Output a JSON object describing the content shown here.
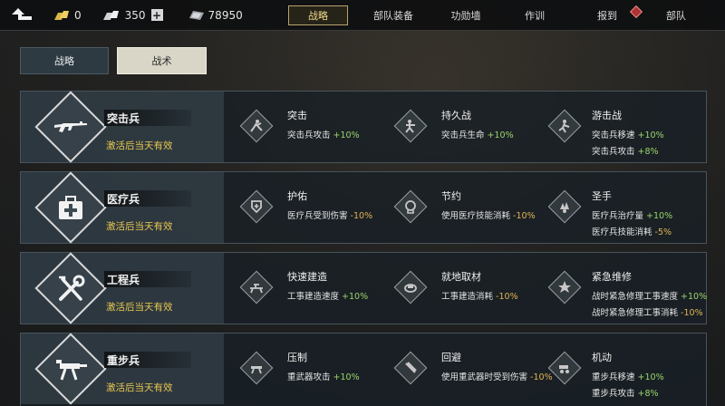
{
  "topbar": {
    "gold": "0",
    "fuel": "350",
    "silver": "78950",
    "nav": [
      "战略",
      "部队装备",
      "功勋墙",
      "作训",
      "报到",
      "部队"
    ],
    "active": "战略"
  },
  "tabs": [
    "战略",
    "战术"
  ],
  "active_tab": "战术",
  "classes": [
    {
      "name": "突击兵",
      "note": "激活后当天有效",
      "icon": "rifle-icon",
      "perks": [
        {
          "title": "突击",
          "icon": "assault-perk-icon",
          "lines": [
            {
              "label": "突击兵攻击",
              "value": "+10%"
            }
          ]
        },
        {
          "title": "持久战",
          "icon": "endurance-perk-icon",
          "lines": [
            {
              "label": "突击兵生命",
              "value": "+10%"
            }
          ]
        },
        {
          "title": "游击战",
          "icon": "guerrilla-perk-icon",
          "lines": [
            {
              "label": "突击兵移速",
              "value": "+10%"
            },
            {
              "label": "突击兵攻击",
              "value": "+8%"
            }
          ]
        }
      ]
    },
    {
      "name": "医疗兵",
      "note": "激活后当天有效",
      "icon": "medkit-icon",
      "perks": [
        {
          "title": "护佑",
          "icon": "shield-perk-icon",
          "lines": [
            {
              "label": "医疗兵受到伤害",
              "value": "-10%"
            }
          ]
        },
        {
          "title": "节约",
          "icon": "save-perk-icon",
          "lines": [
            {
              "label": "使用医疗技能消耗",
              "value": "-10%"
            }
          ]
        },
        {
          "title": "圣手",
          "icon": "hand-perk-icon",
          "lines": [
            {
              "label": "医疗兵治疗量",
              "value": "+10%"
            },
            {
              "label": "医疗兵技能消耗",
              "value": "-5%"
            }
          ]
        }
      ]
    },
    {
      "name": "工程兵",
      "note": "激活后当天有效",
      "icon": "wrench-icon",
      "perks": [
        {
          "title": "快速建造",
          "icon": "build-perk-icon",
          "lines": [
            {
              "label": "工事建造速度",
              "value": "+10%"
            }
          ]
        },
        {
          "title": "就地取材",
          "icon": "material-perk-icon",
          "lines": [
            {
              "label": "工事建造消耗",
              "value": "-10%"
            }
          ]
        },
        {
          "title": "紧急维修",
          "icon": "repair-perk-icon",
          "lines": [
            {
              "label": "战时紧急修理工事速度",
              "value": "+10%"
            },
            {
              "label": "战时紧急修理工事消耗",
              "value": "-10%"
            }
          ]
        }
      ]
    },
    {
      "name": "重步兵",
      "note": "激活后当天有效",
      "icon": "heavy-gun-icon",
      "perks": [
        {
          "title": "压制",
          "icon": "suppress-perk-icon",
          "lines": [
            {
              "label": "重武器攻击",
              "value": "+10%"
            }
          ]
        },
        {
          "title": "回避",
          "icon": "evade-perk-icon",
          "lines": [
            {
              "label": "使用重武器时受到伤害",
              "value": "-10%"
            }
          ]
        },
        {
          "title": "机动",
          "icon": "mobility-perk-icon",
          "lines": [
            {
              "label": "重步兵移速",
              "value": "+10%"
            },
            {
              "label": "重步兵攻击",
              "value": "+8%"
            }
          ]
        }
      ]
    }
  ]
}
